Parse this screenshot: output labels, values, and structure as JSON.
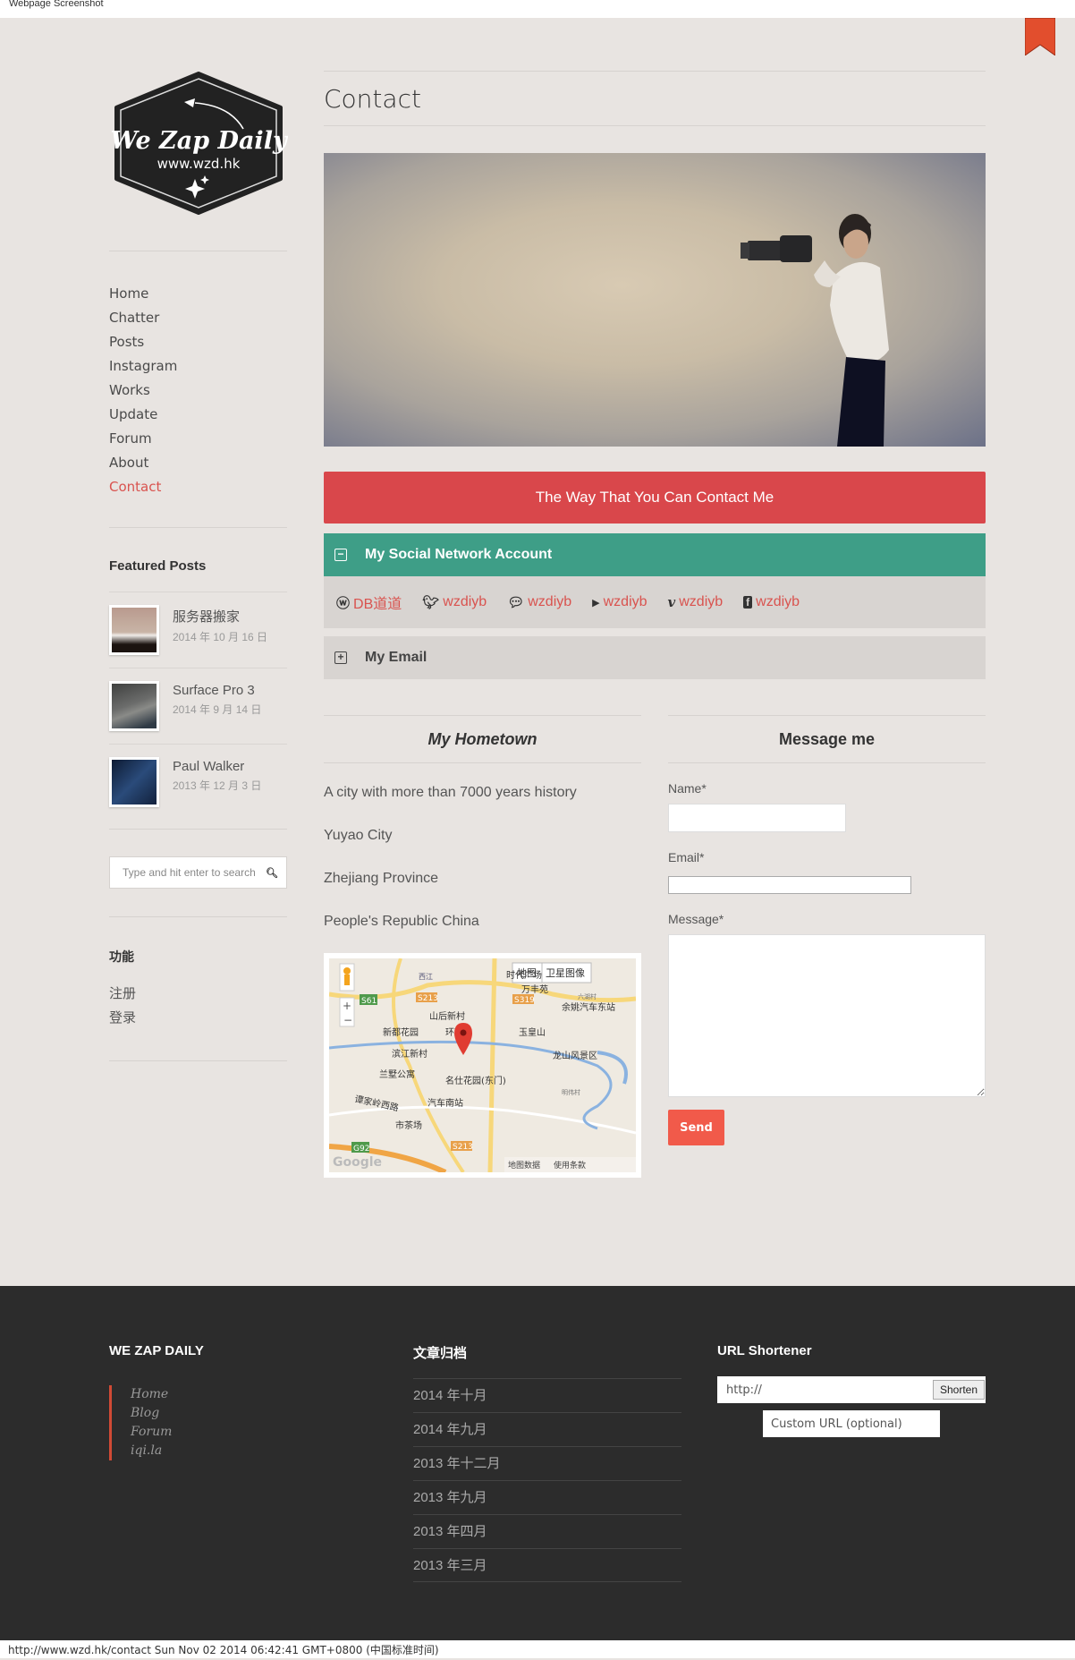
{
  "window": {
    "title": "Webpage Screenshot"
  },
  "logo": {
    "title": "We Zap Daily",
    "url": "www.wzd.hk"
  },
  "nav": {
    "items": [
      {
        "label": "Home"
      },
      {
        "label": "Chatter"
      },
      {
        "label": "Posts"
      },
      {
        "label": "Instagram"
      },
      {
        "label": "Works"
      },
      {
        "label": "Update"
      },
      {
        "label": "Forum"
      },
      {
        "label": "About"
      },
      {
        "label": "Contact",
        "active": true
      }
    ]
  },
  "featured": {
    "title": "Featured Posts",
    "posts": [
      {
        "title": "服务器搬家",
        "date": "2014 年 10 月 16 日"
      },
      {
        "title": "Surface Pro 3",
        "date": "2014 年 9 月 14 日"
      },
      {
        "title": "Paul Walker",
        "date": "2013 年 12 月 3 日"
      }
    ]
  },
  "search": {
    "placeholder": "Type and hit enter to search",
    "icon": "search-icon"
  },
  "functions": {
    "title": "功能",
    "items": [
      {
        "label": "注册"
      },
      {
        "label": "登录"
      }
    ]
  },
  "main": {
    "page_title": "Contact",
    "hero_alt": "Photographer with camera",
    "banner": "The Way That You Can Contact Me",
    "social_section": {
      "title": "My Social Network Account",
      "expanded": true,
      "accounts": [
        {
          "icon": "weibo-icon",
          "glyph": "ⓦ",
          "label": "DB道道"
        },
        {
          "icon": "twitter-icon",
          "glyph": "🐦",
          "label": "wzdiyb"
        },
        {
          "icon": "wechat-icon",
          "glyph": "💬",
          "label": "wzdiyb"
        },
        {
          "icon": "youtube-icon",
          "glyph": "▶",
          "label": "wzdiyb"
        },
        {
          "icon": "vimeo-icon",
          "glyph": "v",
          "label": "wzdiyb"
        },
        {
          "icon": "facebook-icon",
          "glyph": "f",
          "label": "wzdiyb"
        }
      ]
    },
    "email_section": {
      "title": "My Email",
      "expanded": false
    },
    "hometown": {
      "title": "My Hometown",
      "lines": [
        "A city with more than 7000 years history",
        "Yuyao City",
        "Zhejiang Province",
        "People's Republic China"
      ]
    },
    "map": {
      "type_buttons": [
        "地图",
        "卫星图像"
      ],
      "labels": [
        "时代广场",
        "万丰苑",
        "余姚汽车东站",
        "山后新村",
        "新都花园",
        "环球大",
        "玉皇山",
        "滨江新村",
        "龙山风景区",
        "兰墅公寓",
        "名仕花园(东门)",
        "谭家岭西路",
        "汽车南站",
        "市茶场",
        "西江",
        "六湖村",
        "明伟村"
      ],
      "road_badges": [
        "S61",
        "S213",
        "S319",
        "G92",
        "S213"
      ],
      "footer": [
        "地图数据",
        "使用条款"
      ],
      "brand": "Google"
    },
    "message_form": {
      "title": "Message me",
      "name_label": "Name*",
      "name_value": "",
      "email_label": "Email*",
      "email_value": "",
      "message_label": "Message*",
      "message_value": "",
      "send_label": "Send"
    }
  },
  "footer": {
    "brand": {
      "title": "WE ZAP DAILY",
      "links": [
        {
          "label": "Home"
        },
        {
          "label": "Blog"
        },
        {
          "label": "Forum"
        },
        {
          "label": "iqi.la"
        }
      ]
    },
    "archives": {
      "title": "文章归档",
      "items": [
        {
          "label": "2014 年十月"
        },
        {
          "label": "2014 年九月"
        },
        {
          "label": "2013 年十二月"
        },
        {
          "label": "2013 年九月"
        },
        {
          "label": "2013 年四月"
        },
        {
          "label": "2013 年三月"
        }
      ]
    },
    "shortener": {
      "title": "URL Shortener",
      "url_value": "http://",
      "button": "Shorten",
      "custom_placeholder": "Custom URL (optional)"
    }
  },
  "statusbar": {
    "text": "http://www.wzd.hk/contact Sun Nov 02 2014 06:42:41 GMT+0800 (中国标准时间)"
  },
  "colors": {
    "accent_red": "#d9474b",
    "teal": "#3e9e87",
    "send": "#f15a4a",
    "footer_bg": "#2c2c2c",
    "page_bg": "#e8e4e1"
  }
}
